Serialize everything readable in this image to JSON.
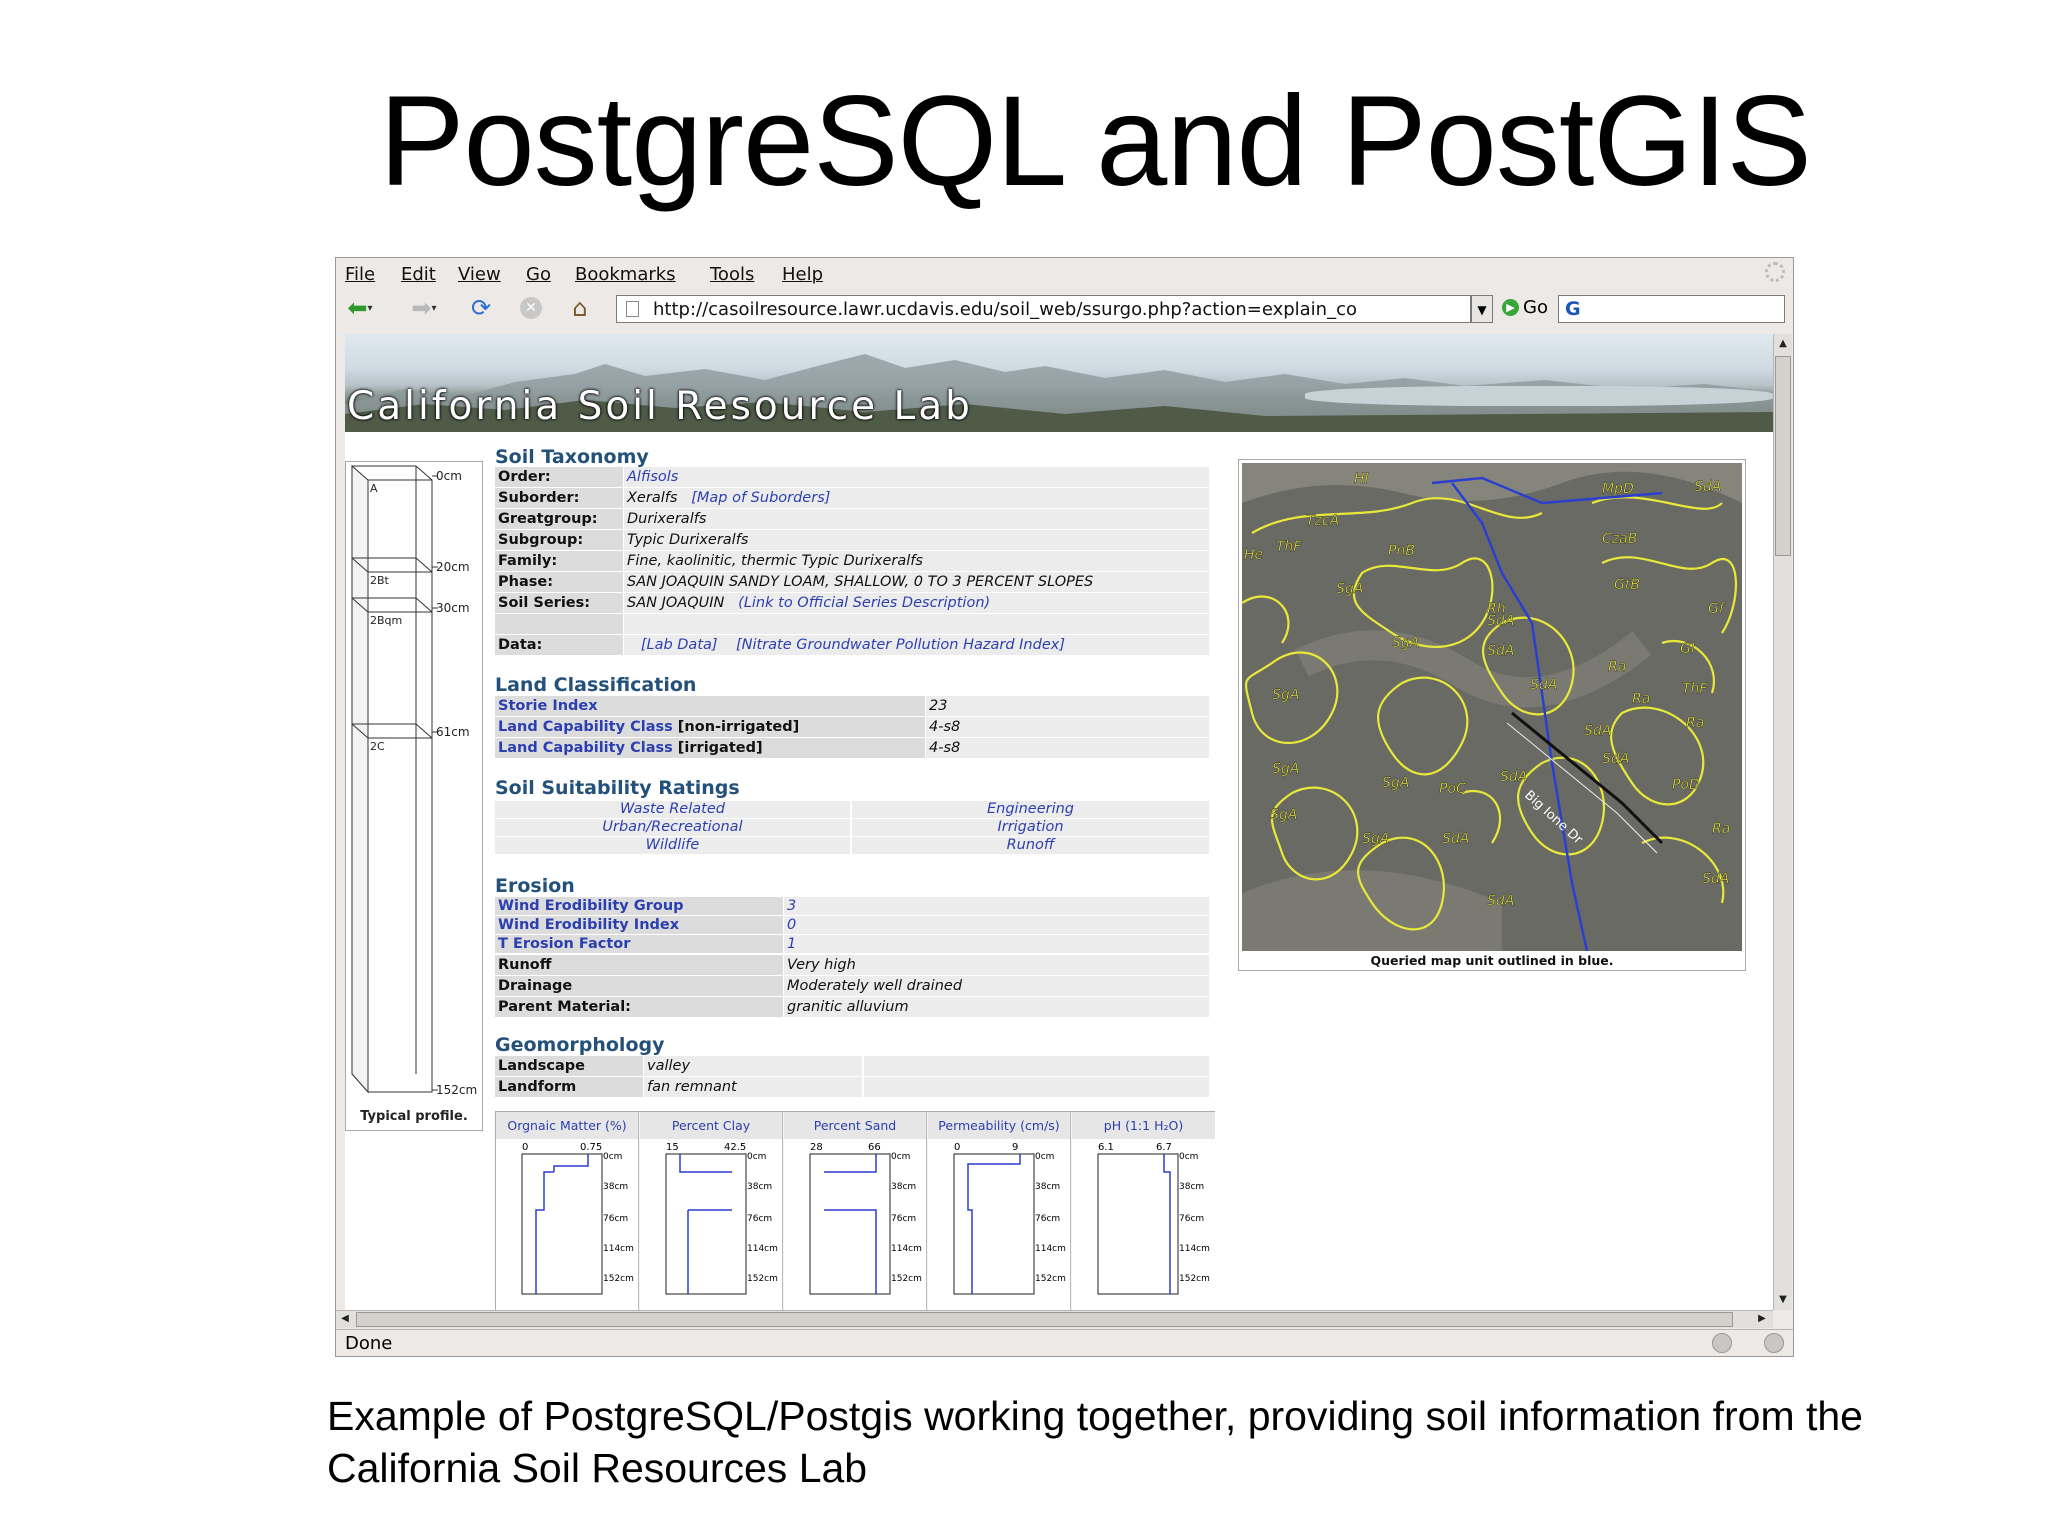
{
  "slide": {
    "title": "PostgreSQL and PostGIS",
    "caption": "Example of PostgreSQL/Postgis working together, providing soil information from the California Soil Resources Lab"
  },
  "browser": {
    "menu": [
      "File",
      "Edit",
      "View",
      "Go",
      "Bookmarks",
      "Tools",
      "Help"
    ],
    "url": "http://casoilresource.lawr.ucdavis.edu/soil_web/ssurgo.php?action=explain_co",
    "go_label": "Go",
    "status": "Done"
  },
  "page": {
    "banner_title": "California Soil Resource Lab",
    "profile": {
      "depths": [
        "0cm",
        "20cm",
        "30cm",
        "61cm",
        "152cm"
      ],
      "horizons": [
        "A",
        "2Bt",
        "2Bqm",
        "2C"
      ],
      "caption": "Typical profile."
    },
    "taxonomy": {
      "heading": "Soil Taxonomy",
      "order_label": "Order:",
      "order": "Alfisols",
      "suborder_label": "Suborder:",
      "suborder": "Xeralfs",
      "suborder_link": "[Map of Suborders]",
      "greatgroup_label": "Greatgroup:",
      "greatgroup": "Durixeralfs",
      "subgroup_label": "Subgroup:",
      "subgroup": "Typic Durixeralfs",
      "family_label": "Family:",
      "family": "Fine, kaolinitic, thermic Typic Durixeralfs",
      "phase_label": "Phase:",
      "phase": "SAN JOAQUIN SANDY LOAM, SHALLOW, 0 TO 3 PERCENT SLOPES",
      "series_label": "Soil Series:",
      "series": "SAN JOAQUIN",
      "series_link": "(Link to Official Series Description)",
      "data_label": "Data:",
      "data_link1": "[Lab Data]",
      "data_link2": "[Nitrate Groundwater Pollution Hazard Index]"
    },
    "land_class": {
      "heading": "Land Classification",
      "storie_label": "Storie Index",
      "storie": "23",
      "lcc_nonirr_label": "Land Capability Class",
      "lcc_nonirr_suffix": " [non-irrigated]",
      "lcc_nonirr": "4-s8",
      "lcc_irr_label": "Land Capability Class",
      "lcc_irr_suffix": " [irrigated]",
      "lcc_irr": "4-s8"
    },
    "suitability": {
      "heading": "Soil Suitability Ratings",
      "items": [
        "Waste Related",
        "Engineering",
        "Urban/Recreational",
        "Irrigation",
        "Wildlife",
        "Runoff"
      ]
    },
    "erosion": {
      "heading": "Erosion",
      "weg_label": "Wind Erodibility Group",
      "weg": "3",
      "wei_label": "Wind Erodibility Index",
      "wei": "0",
      "tfactor_label": "T Erosion Factor",
      "tfactor": "1",
      "runoff_label": "Runoff",
      "runoff": "Very high",
      "drainage_label": "Drainage",
      "drainage": "Moderately well drained",
      "parent_label": "Parent Material:",
      "parent": "granitic alluvium"
    },
    "geomorph": {
      "heading": "Geomorphology",
      "landscape_label": "Landscape",
      "landscape": "valley",
      "landform_label": "Landform",
      "landform": "fan remnant"
    },
    "map": {
      "caption": "Queried map unit outlined in blue.",
      "road_label": "Big Ione Dr",
      "units": [
        "HI",
        "MpD",
        "SdA",
        "TzcA",
        "ThF",
        "PnB",
        "CzaB",
        "He",
        "SgA",
        "GtB",
        "Rh",
        "Gf",
        "Gl",
        "Ra",
        "PoC",
        "PoD"
      ]
    },
    "graphs": {
      "depth_labels": [
        "0cm",
        "38cm",
        "76cm",
        "114cm",
        "152cm"
      ],
      "items": [
        {
          "title": "Orgnaic Matter (%)",
          "min": "0",
          "max": "0.75"
        },
        {
          "title": "Percent Clay",
          "min": "15",
          "max": "42.5"
        },
        {
          "title": "Percent Sand",
          "min": "28",
          "max": "66"
        },
        {
          "title": "Permeability (cm/s)",
          "min": "0",
          "max": "9"
        },
        {
          "title": "pH (1:1 H₂O)",
          "min": "6.1",
          "max": "6.7"
        }
      ]
    }
  },
  "colors": {
    "heading": "#23517a",
    "link": "#2c3fb0",
    "map_outline": "#e8e83a",
    "queried_outline": "#2a3fd0"
  }
}
